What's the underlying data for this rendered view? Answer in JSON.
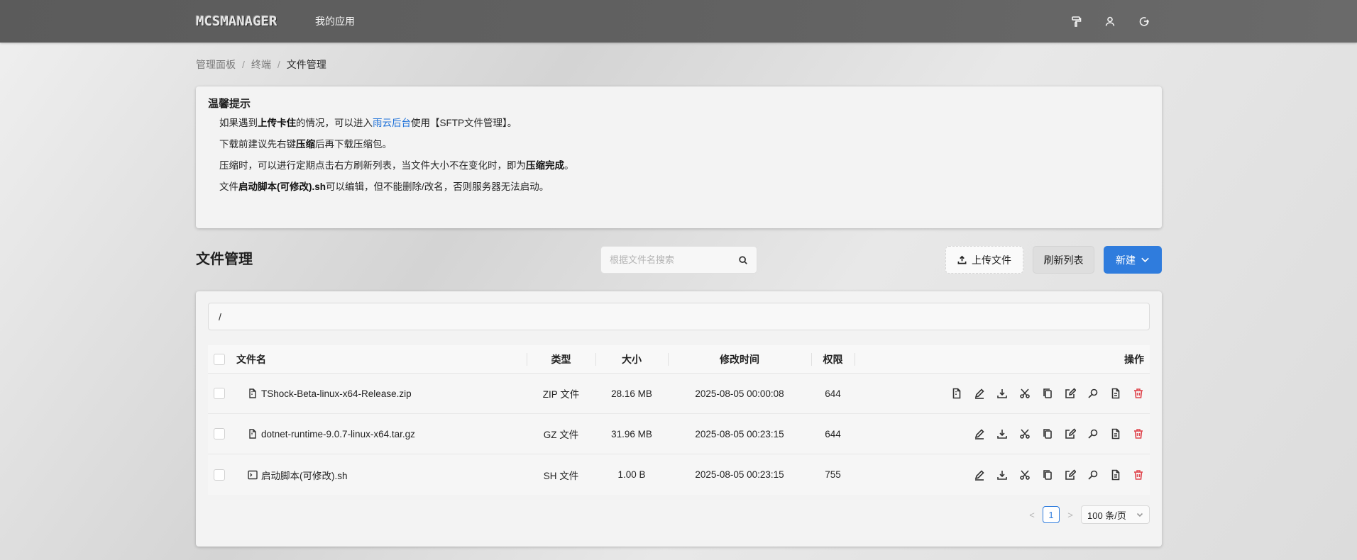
{
  "header": {
    "logo_text": "MCSMANAGER",
    "nav_my_apps": "我的应用",
    "icons": [
      "paint-roller-icon",
      "user-icon",
      "logout-icon"
    ]
  },
  "breadcrumb": {
    "items": [
      "管理面板",
      "终端",
      "文件管理"
    ],
    "separator": "/"
  },
  "tips": {
    "title": "温馨提示",
    "line1": {
      "a": "如果遇到",
      "b": "上传卡住",
      "c": "的情况，可以进入",
      "link": "雨云后台",
      "d": "使用【SFTP文件管理】。"
    },
    "line2": {
      "a": "下载前建议先右键",
      "b": "压缩",
      "c": "后再下载压缩包。"
    },
    "line3": {
      "a": "压缩时，可以进行定期点击右方刷新列表，当文件大小不在变化时，即为",
      "b": "压缩完成",
      "c": "。"
    },
    "line4": {
      "a": "文件",
      "b": "启动脚本(可修改).sh",
      "c": "可以编辑，但不能删除/改名，否则服务器无法启动。"
    }
  },
  "file_manager": {
    "title": "文件管理",
    "search_placeholder": "根据文件名搜索",
    "upload_label": "上传文件",
    "refresh_label": "刷新列表",
    "new_label": "新建",
    "current_path": "/"
  },
  "table": {
    "headers": {
      "name": "文件名",
      "type": "类型",
      "size": "大小",
      "mtime": "修改时间",
      "perm": "权限",
      "actions": "操作"
    },
    "rows": [
      {
        "name": "TShock-Beta-linux-x64-Release.zip",
        "type": "ZIP 文件",
        "size": "28.16 MB",
        "mtime": "2025-08-05 00:00:08",
        "perm": "644",
        "icon": "file-icon"
      },
      {
        "name": "dotnet-runtime-9.0.7-linux-x64.tar.gz",
        "type": "GZ 文件",
        "size": "31.96 MB",
        "mtime": "2025-08-05 00:23:15",
        "perm": "644",
        "icon": "file-icon"
      },
      {
        "name": "启动脚本(可修改).sh",
        "type": "SH 文件",
        "size": "1.00 B",
        "mtime": "2025-08-05 00:23:15",
        "perm": "755",
        "icon": "terminal-icon"
      }
    ]
  },
  "pagination": {
    "prev": "<",
    "current_page": "1",
    "next": ">",
    "page_size": "100 条/页"
  },
  "colors": {
    "accent": "#2f7cdd",
    "danger": "#e0474f",
    "topbar": "#5f5f5f"
  }
}
